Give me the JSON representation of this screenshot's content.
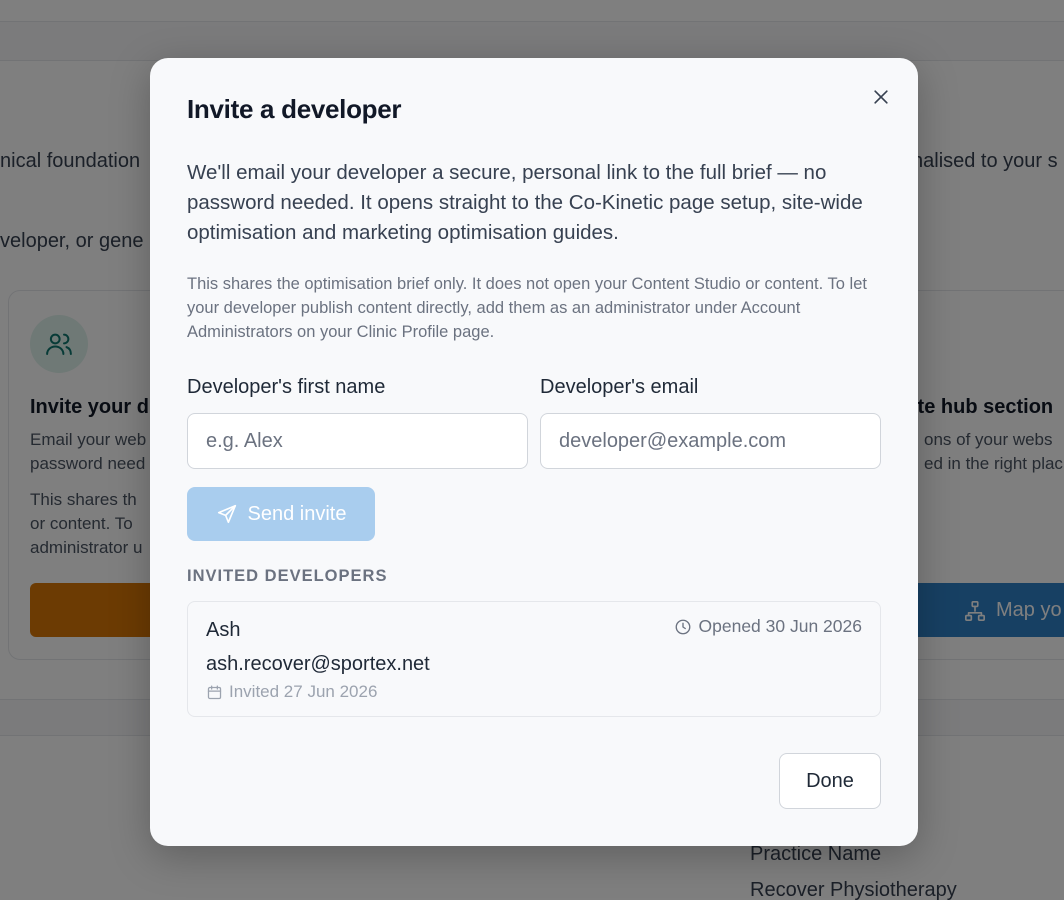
{
  "background": {
    "intro_line_1": "nical foundation",
    "intro_right_1": "nalised to your s",
    "intro_line_2": "veloper, or gene",
    "left_card": {
      "icon": "users-icon",
      "title": "Invite your d",
      "text_1": "Email your web",
      "text_2": "password need",
      "text_3": "This shares th",
      "text_4": "or content. To",
      "text_5": "administrator u"
    },
    "right_card": {
      "title": "ite hub section",
      "text_1": "ons of your webs",
      "text_2": "ed in the right plac",
      "button_label": "Map yo",
      "button_icon": "sitemap-icon"
    },
    "lower": {
      "label": "Practice Name",
      "value": "Recover Physiotherapy"
    }
  },
  "modal": {
    "title": "Invite a developer",
    "close_icon": "close-icon",
    "intro": "We'll email your developer a secure, personal link to the full brief — no password needed. It opens straight to the Co-Kinetic page setup, site-wide optimisation and marketing optimisation guides.",
    "note": "This shares the optimisation brief only. It does not open your Content Studio or content. To let your developer publish content directly, add them as an administrator under Account Administrators on your Clinic Profile page.",
    "form": {
      "first_name_label": "Developer's first name",
      "first_name_placeholder": "e.g. Alex",
      "first_name_value": "",
      "email_label": "Developer's email",
      "email_placeholder": "developer@example.com",
      "email_value": "",
      "send_label": "Send invite",
      "send_icon": "send-icon"
    },
    "invited_heading": "INVITED DEVELOPERS",
    "invited": [
      {
        "name": "Ash",
        "email": "ash.recover@sportex.net",
        "invited_text": "Invited 27 Jun 2026",
        "opened_text": "Opened 30 Jun 2026"
      }
    ],
    "done_label": "Done"
  },
  "colors": {
    "send_button_disabled": "#a9cdee",
    "overlay": "rgba(0,0,0,0.5)",
    "modal_bg": "#f8f9fb"
  }
}
